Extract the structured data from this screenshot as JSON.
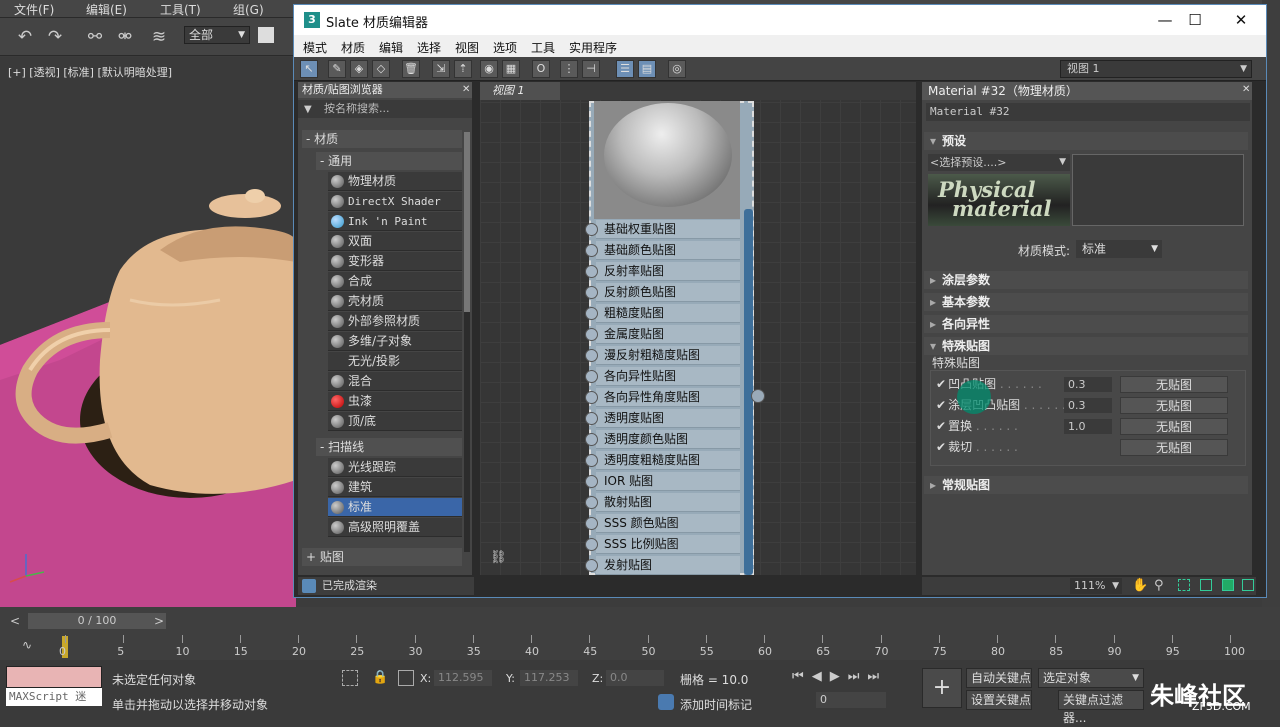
{
  "app": {
    "menu": [
      "文件(F)",
      "编辑(E)",
      "工具(T)",
      "组(G)"
    ],
    "selection_filter": "全部",
    "viewport_label": "[+] [透视] [标准] [默认明暗处理]"
  },
  "slate": {
    "title": "Slate 材质编辑器",
    "menu": [
      "模式",
      "材质",
      "编辑",
      "选择",
      "视图",
      "选项",
      "工具",
      "实用程序"
    ],
    "view_selector": "视图 1",
    "browser": {
      "title": "材质/贴图浏览器",
      "search_placeholder": "按名称搜索...",
      "materials_header": "- 材质",
      "general_header": "- 通用",
      "general_items": [
        "物理材质",
        "DirectX Shader",
        "Ink 'n Paint",
        "双面",
        "变形器",
        "合成",
        "壳材质",
        "外部参照材质",
        "多维/子对象",
        "无光/投影",
        "混合",
        "虫漆",
        "顶/底"
      ],
      "scanline_header": "- 扫描线",
      "scanline_items": [
        "光线跟踪",
        "建筑",
        "标准",
        "高级照明覆盖"
      ],
      "maps_header": "+ 贴图",
      "status": "已完成渲染"
    },
    "node_view": {
      "tab": "视图 1",
      "slots": [
        "基础权重贴图",
        "基础颜色贴图",
        "反射率贴图",
        "反射颜色贴图",
        "粗糙度贴图",
        "金属度贴图",
        "漫反射粗糙度贴图",
        "各向异性贴图",
        "各向异性角度贴图",
        "透明度贴图",
        "透明度颜色贴图",
        "透明度粗糙度贴图",
        "IOR 贴图",
        "散射贴图",
        "SSS 颜色贴图",
        "SSS 比例贴图",
        "发射贴图"
      ]
    },
    "params": {
      "title": "Material #32（物理材质）",
      "name": "Material #32",
      "preset_rollout": "预设",
      "preset_select": "<选择预设....>",
      "logo_line1": "Physical",
      "logo_line2": "material",
      "mode_label": "材质模式:",
      "mode_value": "标准",
      "rollouts": [
        "涂层参数",
        "基本参数",
        "各向异性",
        "特殊贴图"
      ],
      "special_group": "特殊贴图",
      "special_maps": [
        {
          "label": "凹凸贴图",
          "value": "0.3",
          "button": "无贴图"
        },
        {
          "label": "涂层凹凸贴图",
          "value": "0.3",
          "button": "无贴图"
        },
        {
          "label": "置换",
          "value": "1.0",
          "button": "无贴图"
        },
        {
          "label": "裁切",
          "value": "",
          "button": "无贴图"
        }
      ],
      "general_maps": "常规贴图",
      "zoom": "111%"
    }
  },
  "timeline": {
    "frame": "0 / 100",
    "ticks": [
      "0",
      "5",
      "10",
      "15",
      "20",
      "25",
      "30",
      "35",
      "40",
      "45",
      "50",
      "55",
      "60",
      "65",
      "70",
      "75",
      "80",
      "85",
      "90",
      "95",
      "100"
    ]
  },
  "status": {
    "script": "MAXScript 迷",
    "line1": "未选定任何对象",
    "line2": "单击并拖动以选择并移动对象",
    "x_label": "X:",
    "x_value": "112.595",
    "y_label": "Y:",
    "y_value": "117.253",
    "z_label": "Z:",
    "z_value": "0.0",
    "grid": "栅格 = 10.0",
    "add_time_tag": "添加时间标记",
    "auto_key": "自动关键点",
    "set_key": "设置关键点",
    "selected_objects": "选定对象",
    "key_filter": "关键点过滤器...",
    "frame_field": "0"
  },
  "watermark": {
    "line1": "朱峰社区",
    "line2": "ZF3D.COM"
  }
}
